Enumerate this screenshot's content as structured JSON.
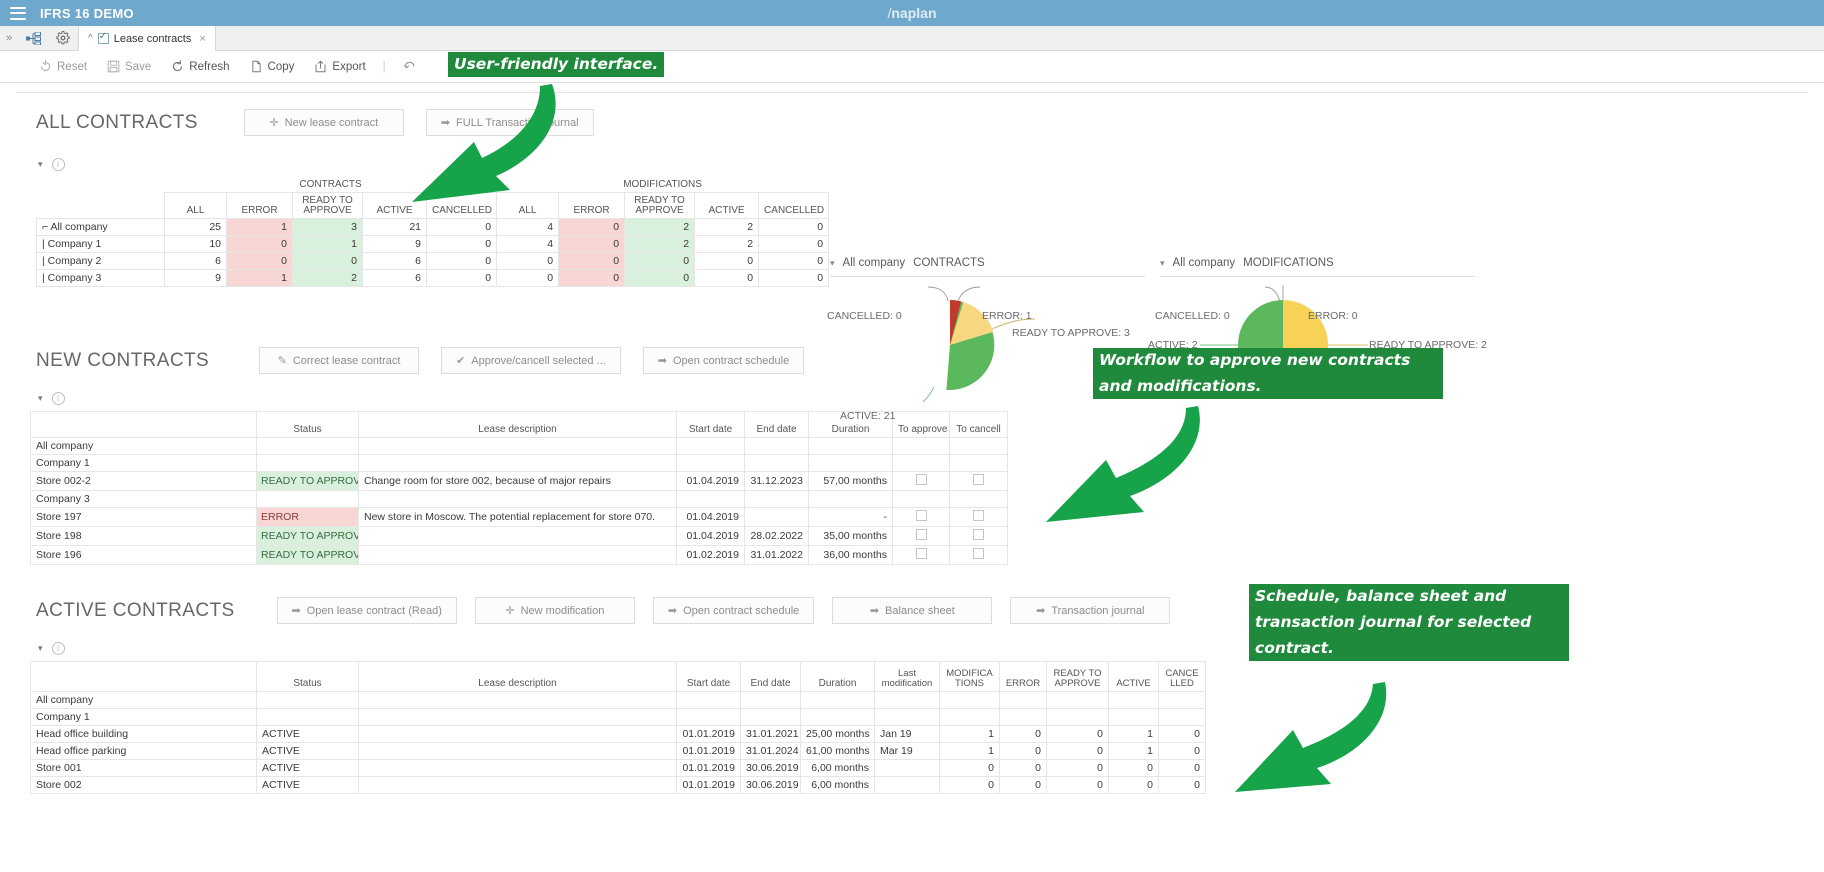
{
  "window": {
    "app_title": "IFRS 16 DEMO",
    "brand": "Anaplan",
    "brand_slash": "/",
    "brand_rest": "naplan",
    "menu_icon": "hamburger-icon"
  },
  "tabstrip": {
    "expand_icon": "chevron-right-icon",
    "module_icon": "module-tree-icon",
    "settings_icon": "gear-icon",
    "tab": {
      "collapse_icon": "chevron-up-icon",
      "checkbox_icon": "checked-box-icon",
      "label": "Lease contracts",
      "close_icon": "close-icon"
    }
  },
  "toolbar": {
    "reset": "Reset",
    "save": "Save",
    "refresh": "Refresh",
    "copy": "Copy",
    "export": "Export",
    "undo_icon": "undo-arrow-icon",
    "separator": "|"
  },
  "all_contracts": {
    "title": "ALL CONTRACTS",
    "buttons": [
      {
        "label": "New lease contract",
        "icon": "plus-icon"
      },
      {
        "label": "FULL Transaction journal",
        "icon": "arrow-right-icon"
      }
    ],
    "group_headers": [
      "CONTRACTS",
      "MODIFICATIONS"
    ],
    "columns": [
      "ALL",
      "ERROR",
      "READY TO APPROVE",
      "ACTIVE",
      "CANCELLED",
      "ALL",
      "ERROR",
      "READY TO APPROVE",
      "ACTIVE",
      "CANCELLED"
    ],
    "rows": [
      {
        "label": "All company",
        "level": 1,
        "total": true,
        "values": [
          "25",
          "1",
          "3",
          "21",
          "0",
          "4",
          "0",
          "2",
          "2",
          "0"
        ]
      },
      {
        "label": "Company 1",
        "level": 2,
        "total": false,
        "values": [
          "10",
          "0",
          "1",
          "9",
          "0",
          "4",
          "0",
          "2",
          "2",
          "0"
        ]
      },
      {
        "label": "Company 2",
        "level": 2,
        "total": false,
        "values": [
          "6",
          "0",
          "0",
          "6",
          "0",
          "0",
          "0",
          "0",
          "0",
          "0"
        ]
      },
      {
        "label": "Company 3",
        "level": 2,
        "total": false,
        "values": [
          "9",
          "1",
          "2",
          "6",
          "0",
          "0",
          "0",
          "0",
          "0",
          "0"
        ]
      }
    ]
  },
  "pie_contracts": {
    "caret_icon": "caret-down-icon",
    "scope": "All company",
    "measure": "CONTRACTS",
    "labels": {
      "cancelled": "CANCELLED: 0",
      "error": "ERROR: 1",
      "ready": "READY TO APPROVE: 3",
      "active": "ACTIVE: 21"
    }
  },
  "pie_modifications": {
    "caret_icon": "caret-down-icon",
    "scope": "All company",
    "measure": "MODIFICATIONS",
    "labels": {
      "cancelled": "CANCELLED: 0",
      "error": "ERROR: 0",
      "ready": "READY TO APPROVE: 2",
      "active": "ACTIVE: 2"
    }
  },
  "chart_data": [
    {
      "type": "pie",
      "title": "All company CONTRACTS",
      "categories": [
        "ACTIVE",
        "READY TO APPROVE",
        "ERROR",
        "CANCELLED"
      ],
      "values": [
        21,
        3,
        1,
        0
      ],
      "colors": [
        "#5cb85c",
        "#f2cf63",
        "#c9302c",
        "#dddddd"
      ],
      "legend": "labels-outside"
    },
    {
      "type": "pie",
      "title": "All company MODIFICATIONS",
      "categories": [
        "ACTIVE",
        "READY TO APPROVE",
        "ERROR",
        "CANCELLED"
      ],
      "values": [
        2,
        2,
        0,
        0
      ],
      "colors": [
        "#5cb85c",
        "#f2cf63",
        "#c9302c",
        "#dddddd"
      ],
      "legend": "labels-outside"
    }
  ],
  "new_contracts": {
    "title": "NEW CONTRACTS",
    "buttons": [
      {
        "label": "Correct lease contract",
        "icon": "pencil-icon"
      },
      {
        "label": "Approve/cancell selected ...",
        "icon": "check-flag-icon"
      },
      {
        "label": "Open contract schedule",
        "icon": "arrow-right-icon"
      }
    ],
    "columns": [
      "",
      "Status",
      "Lease description",
      "Start date",
      "End date",
      "Duration",
      "To approve",
      "To cancell"
    ],
    "rows": [
      {
        "label": "All company",
        "level": 1,
        "status": "",
        "status_kind": "none",
        "description": "",
        "start": "",
        "end": "",
        "duration": "",
        "checkboxes": false
      },
      {
        "label": "Company 1",
        "level": 2,
        "status": "",
        "status_kind": "none",
        "description": "",
        "start": "",
        "end": "",
        "duration": "",
        "checkboxes": false
      },
      {
        "label": "Store 002-2",
        "level": 3,
        "status": "READY TO APPROVE",
        "status_kind": "ready",
        "description": "Change room for store 002, because of major repairs",
        "start": "01.04.2019",
        "end": "31.12.2023",
        "duration": "57,00 months",
        "checkboxes": true
      },
      {
        "label": "Company 3",
        "level": 2,
        "status": "",
        "status_kind": "none",
        "description": "",
        "start": "",
        "end": "",
        "duration": "",
        "checkboxes": false
      },
      {
        "label": "Store 197",
        "level": 3,
        "status": "ERROR",
        "status_kind": "error",
        "description": "New store in Moscow. The potential replacement for store 070.",
        "start": "01.04.2019",
        "end": "",
        "duration": "-",
        "checkboxes": true
      },
      {
        "label": "Store 198",
        "level": 3,
        "status": "READY TO APPROVE",
        "status_kind": "ready",
        "description": "",
        "start": "01.04.2019",
        "end": "28.02.2022",
        "duration": "35,00 months",
        "checkboxes": true
      },
      {
        "label": "Store 196",
        "level": 3,
        "status": "READY TO APPROVE",
        "status_kind": "ready",
        "description": "",
        "start": "01.02.2019",
        "end": "31.01.2022",
        "duration": "36,00 months",
        "checkboxes": true
      }
    ]
  },
  "active_contracts": {
    "title": "ACTIVE CONTRACTS",
    "buttons": [
      {
        "label": "Open lease contract (Read)",
        "icon": "arrow-right-icon"
      },
      {
        "label": "New modification",
        "icon": "plus-icon"
      },
      {
        "label": "Open contract schedule",
        "icon": "arrow-right-icon"
      },
      {
        "label": "Balance sheet",
        "icon": "arrow-right-icon"
      },
      {
        "label": "Transaction journal",
        "icon": "arrow-right-icon"
      }
    ],
    "columns": [
      "",
      "Status",
      "Lease description",
      "Start date",
      "End date",
      "Duration",
      "Last modification",
      "MODIFICATIONS",
      "ERROR",
      "READY TO APPROVE",
      "ACTIVE",
      "CANCELLED"
    ],
    "rows": [
      {
        "label": "All company",
        "level": 1,
        "status": "",
        "description": "",
        "start": "",
        "end": "",
        "duration": "",
        "last_mod": "",
        "mods": "",
        "error": "",
        "ready": "",
        "active": "",
        "cancelled": ""
      },
      {
        "label": "Company 1",
        "level": 2,
        "status": "",
        "description": "",
        "start": "",
        "end": "",
        "duration": "",
        "last_mod": "",
        "mods": "",
        "error": "",
        "ready": "",
        "active": "",
        "cancelled": ""
      },
      {
        "label": "Head office building",
        "level": 3,
        "status": "ACTIVE",
        "description": "",
        "start": "01.01.2019",
        "end": "31.01.2021",
        "duration": "25,00 months",
        "last_mod": "Jan 19",
        "mods": "1",
        "error": "0",
        "ready": "0",
        "active": "1",
        "cancelled": "0"
      },
      {
        "label": "Head office parking",
        "level": 3,
        "status": "ACTIVE",
        "description": "",
        "start": "01.01.2019",
        "end": "31.01.2024",
        "duration": "61,00 months",
        "last_mod": "Mar 19",
        "mods": "1",
        "error": "0",
        "ready": "0",
        "active": "1",
        "cancelled": "0"
      },
      {
        "label": "Store 001",
        "level": 3,
        "status": "ACTIVE",
        "description": "",
        "start": "01.01.2019",
        "end": "30.06.2019",
        "duration": "6,00 months",
        "last_mod": "",
        "mods": "0",
        "error": "0",
        "ready": "0",
        "active": "0",
        "cancelled": "0"
      },
      {
        "label": "Store 002",
        "level": 3,
        "status": "ACTIVE",
        "description": "",
        "start": "01.01.2019",
        "end": "30.06.2019",
        "duration": "6,00 months",
        "last_mod": "",
        "mods": "0",
        "error": "0",
        "ready": "0",
        "active": "0",
        "cancelled": "0"
      }
    ]
  },
  "annotations": [
    {
      "id": "a1",
      "text": "User-friendly interface."
    },
    {
      "id": "a2",
      "line1": "Workflow to approve new contracts",
      "line2": "and modifications."
    },
    {
      "id": "a3",
      "line1": "Schedule, balance sheet and",
      "line2": "transaction journal for selected",
      "line3": "contract."
    }
  ],
  "colors": {
    "brand_bar": "#6fa8cd",
    "annotation_green": "#1f8a3b",
    "status_ready_bg": "#d9f0dc",
    "status_error_bg": "#f8d6d4",
    "pie_active": "#5cb85c",
    "pie_ready": "#f2cf63",
    "pie_error": "#c9302c"
  }
}
